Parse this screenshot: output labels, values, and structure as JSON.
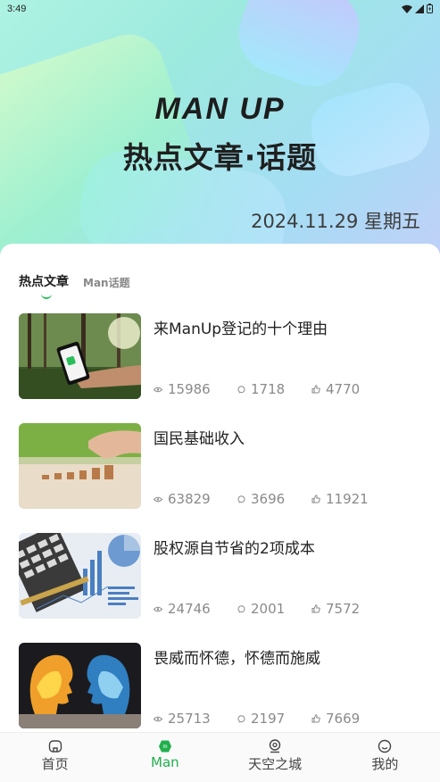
{
  "status_bar": {
    "time": "3:49"
  },
  "hero": {
    "title": "MAN UP",
    "subtitle": "热点文章·话题",
    "date": "2024.11.29 星期五"
  },
  "tabs": [
    {
      "label": "热点文章",
      "active": true
    },
    {
      "label": "Man话题",
      "active": false
    }
  ],
  "articles": [
    {
      "title": "来ManUp登记的十个理由",
      "views": "15986",
      "comments": "1718",
      "likes": "4770",
      "image": "phone-in-hand"
    },
    {
      "title": "国民基础收入",
      "views": "63829",
      "comments": "3696",
      "likes": "11921",
      "image": "stacked-coins"
    },
    {
      "title": "股权源自节省的2项成本",
      "views": "24746",
      "comments": "2001",
      "likes": "7572",
      "image": "calculator-charts"
    },
    {
      "title": "畏威而怀德，怀德而施威",
      "views": "25713",
      "comments": "2197",
      "likes": "7669",
      "image": "fire-water-heads"
    }
  ],
  "bottom_nav": [
    {
      "label": "首页",
      "icon": "home-icon",
      "active": false
    },
    {
      "label": "Man",
      "icon": "man-logo-icon",
      "active": true
    },
    {
      "label": "天空之城",
      "icon": "location-icon",
      "active": false
    },
    {
      "label": "我的",
      "icon": "smile-icon",
      "active": false
    }
  ],
  "colors": {
    "accent": "#20b04d",
    "hero_gradient_start": "#aef3e2",
    "hero_gradient_end": "#c2cff8"
  }
}
